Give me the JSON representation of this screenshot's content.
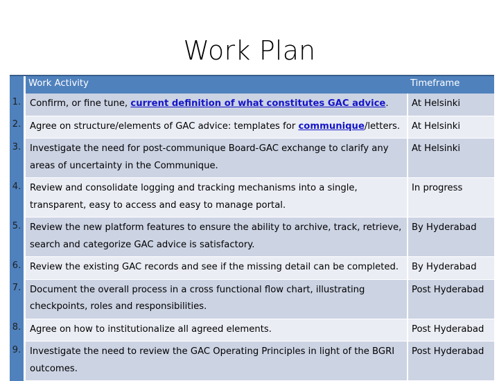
{
  "slide": {
    "title": "Work Plan"
  },
  "table": {
    "headers": {
      "number": "",
      "activity": "Work Activity",
      "timeframe": "Timeframe"
    },
    "rows": [
      {
        "number": "1.",
        "activity_parts": [
          {
            "text": "Confirm, or fine tune, ",
            "link": false
          },
          {
            "text": "current definition of what constitutes GAC advice",
            "link": true
          },
          {
            "text": ".",
            "link": false
          }
        ],
        "activity_plain": "Confirm, or fine tune, current definition of what constitutes GAC advice.",
        "timeframe": "At Helsinki"
      },
      {
        "number": "2.",
        "activity_parts": [
          {
            "text": "Agree on structure/elements of GAC advice: templates for ",
            "link": false
          },
          {
            "text": "communique",
            "link": true
          },
          {
            "text": "/letters.",
            "link": false
          }
        ],
        "activity_plain": "Agree on structure/elements of GAC advice: templates for communique/letters.",
        "timeframe": "At Helsinki"
      },
      {
        "number": "3.",
        "activity_parts": [
          {
            "text": "Investigate the need for post-communique Board-GAC exchange to clarify any areas of uncertainty in the Communique.",
            "link": false
          }
        ],
        "activity_plain": "Investigate the need for post-communique Board-GAC exchange to clarify any areas of uncertainty in the Communique.",
        "timeframe": "At Helsinki"
      },
      {
        "number": "4.",
        "activity_parts": [
          {
            "text": "Review and consolidate logging and tracking mechanisms into a single, transparent, easy to access and easy to manage portal.",
            "link": false
          }
        ],
        "activity_plain": "Review and consolidate logging and tracking mechanisms into a single, transparent, easy to access and easy to manage portal.",
        "timeframe": "In progress"
      },
      {
        "number": "5.",
        "activity_parts": [
          {
            "text": "Review the new platform features to ensure the ability to archive, track, retrieve, search and categorize GAC advice is satisfactory.",
            "link": false
          }
        ],
        "activity_plain": "Review the new platform features to ensure the ability to archive, track, retrieve, search and categorize GAC advice is satisfactory.",
        "timeframe": "By Hyderabad"
      },
      {
        "number": "6.",
        "activity_parts": [
          {
            "text": "Review the existing GAC records and see if the missing detail can be completed.",
            "link": false
          }
        ],
        "activity_plain": "Review the existing GAC records and see if the missing detail can be completed.",
        "timeframe": "By Hyderabad"
      },
      {
        "number": "7.",
        "activity_parts": [
          {
            "text": "Document the overall process in a cross functional flow chart, illustrating checkpoints, roles and responsibilities.",
            "link": false
          }
        ],
        "activity_plain": "Document the overall process in a cross functional flow chart, illustrating checkpoints, roles and responsibilities.",
        "timeframe": "Post Hyderabad"
      },
      {
        "number": "8.",
        "activity_parts": [
          {
            "text": "Agree on how to institutionalize all agreed elements.",
            "link": false
          }
        ],
        "activity_plain": "Agree on how to institutionalize all agreed elements.",
        "timeframe": "Post Hyderabad"
      },
      {
        "number": "9.",
        "activity_parts": [
          {
            "text": "Investigate the need to review the GAC Operating Principles in light of the BGRI outcomes.",
            "link": false
          }
        ],
        "activity_plain": "Investigate the need to review the GAC Operating Principles in light of the BGRI outcomes.",
        "timeframe": "Post Hyderabad"
      }
    ]
  },
  "colors": {
    "header_blue": "#4f81bd",
    "header_top_rule": "#385d8a",
    "band_row": "#ccd3e3",
    "plain_row": "#eaedf4",
    "link_blue": "#1414c8",
    "text": "#000000"
  }
}
